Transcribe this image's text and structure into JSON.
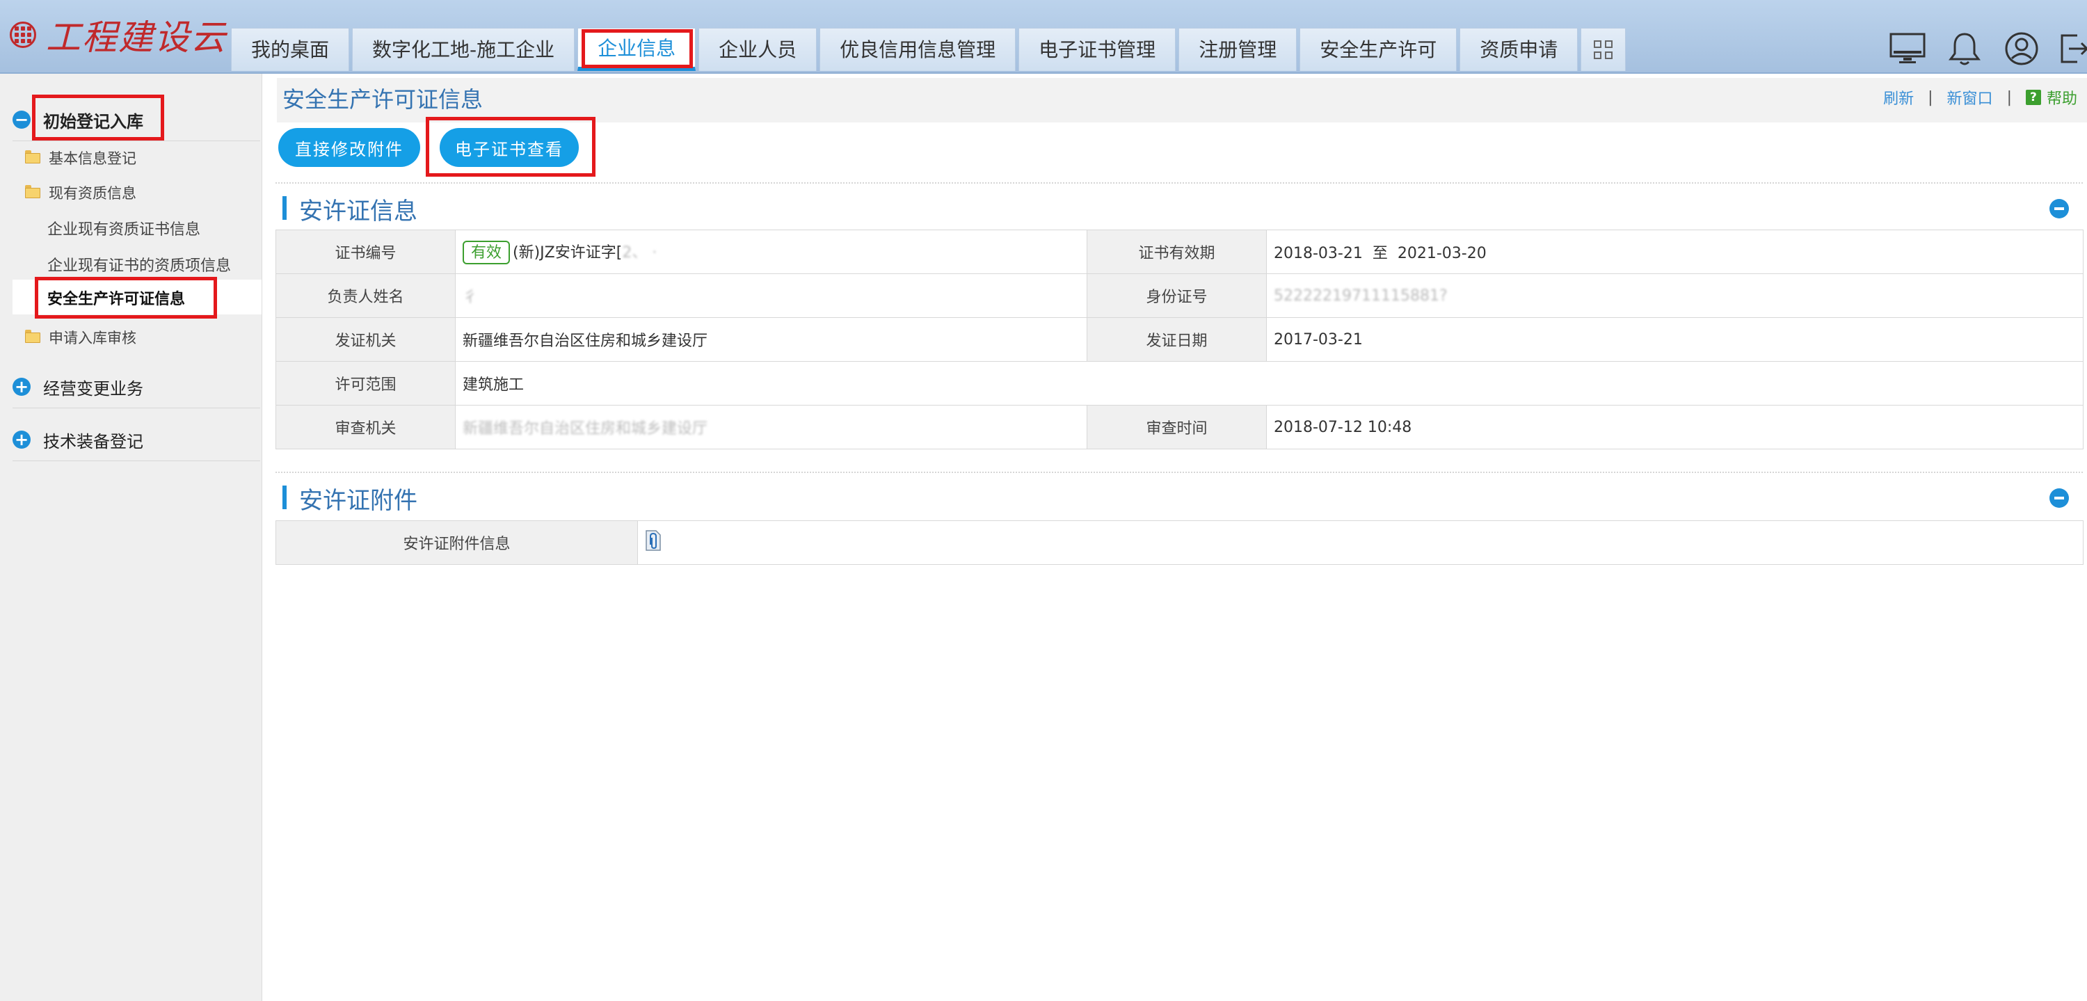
{
  "app": {
    "logo_text": "工程建设云"
  },
  "nav": {
    "tabs": [
      {
        "label": "我的桌面"
      },
      {
        "label": "数字化工地-施工企业"
      },
      {
        "label": "企业信息"
      },
      {
        "label": "企业人员"
      },
      {
        "label": "优良信用信息管理"
      },
      {
        "label": "电子证书管理"
      },
      {
        "label": "注册管理"
      },
      {
        "label": "安全生产许可"
      },
      {
        "label": "资质申请"
      }
    ],
    "active_tab": "企业信息",
    "right_icons": [
      "monitor-icon",
      "bell-icon",
      "user-icon",
      "logout-icon"
    ]
  },
  "sidebar": {
    "section1": "初始登记入库",
    "items": {
      "basic_info": "基本信息登记",
      "qualification_info": "现有资质信息",
      "cert_info": "企业现有资质证书信息",
      "cert_items": "企业现有证书的资质项信息",
      "safety_license": "安全生产许可证信息",
      "review": "申请入库审核"
    },
    "section2": "经营变更业务",
    "section3": "技术装备登记"
  },
  "page": {
    "title": "安全生产许可证信息",
    "links": {
      "refresh": "刷新",
      "sep": "|",
      "new_window": "新窗口",
      "help": "帮助",
      "help_mark": "?"
    },
    "buttons": {
      "edit_attachment": "直接修改附件",
      "view_cert": "电子证书查看"
    }
  },
  "license_panel": {
    "title": "安许证信息",
    "rows": {
      "cert_no_label": "证书编号",
      "cert_no_badge": "有效",
      "cert_no_value": "(新)JZ安许证字[",
      "cert_no_masked": "2、        ·",
      "validity_label": "证书有效期",
      "validity_start": "2018-03-21",
      "validity_to": "至",
      "validity_end": "2021-03-20",
      "person_label": "负责人姓名",
      "person_value": "彳",
      "id_label": "身份证号",
      "id_value": "52222219711115881?",
      "issuer_label": "发证机关",
      "issuer_value": "新疆维吾尔自治区住房和城乡建设厅",
      "issue_date_label": "发证日期",
      "issue_date_value": "2017-03-21",
      "scope_label": "许可范围",
      "scope_value": "建筑施工",
      "review_org_label": "审查机关",
      "review_org_value": "新疆维吾尔自治区住房和城乡建设厅",
      "review_time_label": "审查时间",
      "review_time_value": "2018-07-12 10:48"
    }
  },
  "attachment_panel": {
    "title": "安许证附件",
    "label": "安许证附件信息",
    "icon": "attachment-icon"
  }
}
